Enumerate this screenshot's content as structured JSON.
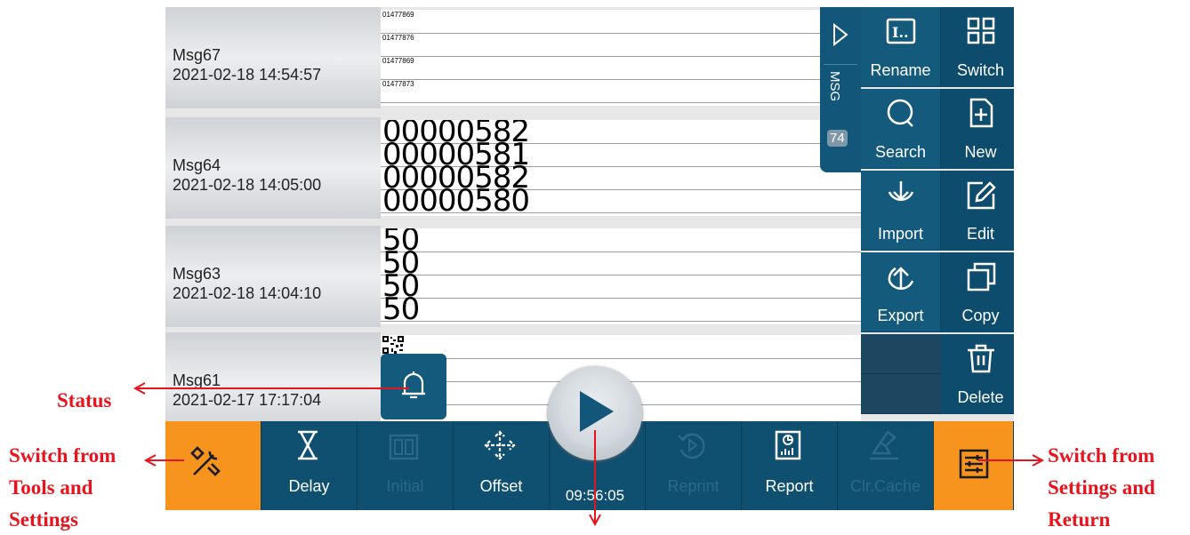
{
  "messages": [
    {
      "name": "Msg67",
      "date": "2021-02-18 14:54:57",
      "preview": [
        "01477869",
        "01477876",
        "01477869",
        "01477873"
      ]
    },
    {
      "name": "Msg64",
      "date": "2021-02-18 14:05:00",
      "preview": [
        "00000582",
        "00000581",
        "00000582",
        "00000580"
      ]
    },
    {
      "name": "Msg63",
      "date": "2021-02-18 14:04:10",
      "preview": [
        "50",
        "50",
        "50",
        "50"
      ]
    },
    {
      "name": "Msg61",
      "date": "2021-02-17 17:17:04",
      "preview": []
    }
  ],
  "msg_tab": {
    "label": "MSG",
    "count": "74"
  },
  "side_buttons": {
    "rename": "Rename",
    "switch": "Switch",
    "search": "Search",
    "new": "New",
    "import": "Import",
    "edit": "Edit",
    "export": "Export",
    "copy": "Copy",
    "delete": "Delete"
  },
  "bottom_bar": {
    "delay": "Delay",
    "initial": "Initial",
    "offset": "Offset",
    "time": "09:56:05",
    "reprint": "Reprint",
    "report": "Report",
    "clr_cache": "Clr.Cache"
  },
  "annotations": {
    "status": "Status",
    "left_1": "Switch from",
    "left_2": "Tools and",
    "left_3": "Settings",
    "right_1": "Switch from",
    "right_2": "Settings and",
    "right_3": "Return"
  },
  "colors": {
    "panel": "#145a7d",
    "accent": "#f7941e",
    "annotation": "#e8141d"
  }
}
